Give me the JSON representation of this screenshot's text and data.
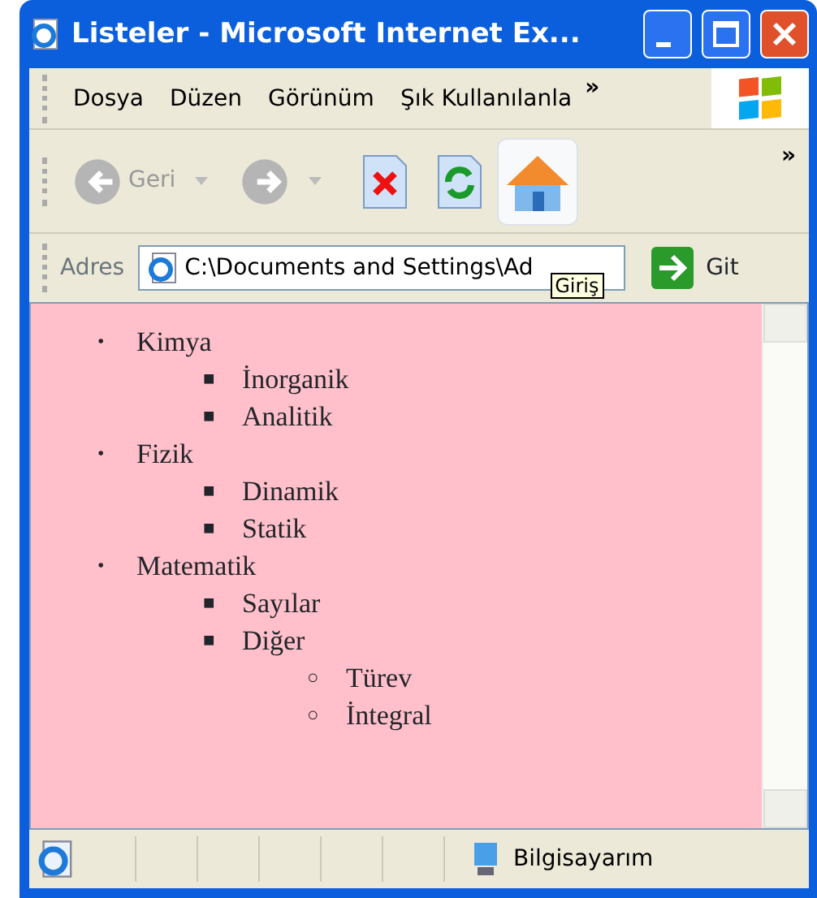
{
  "window": {
    "title": "Listeler - Microsoft Internet Ex..."
  },
  "menu": {
    "items": [
      "Dosya",
      "Düzen",
      "Görünüm",
      "Şık Kullanılanla"
    ],
    "overflow": "»"
  },
  "toolbar": {
    "back": {
      "label": "Geri",
      "disabled": true
    },
    "forward": {
      "disabled": true
    },
    "overflow": "»"
  },
  "address": {
    "label": "Adres",
    "value": "C:\\Documents and Settings\\Ad",
    "tooltip": "Giriş",
    "go_label": "Git"
  },
  "list": [
    {
      "marker": "•",
      "text": "Kimya",
      "children": [
        {
          "marker": "■",
          "text": "İnorganik"
        },
        {
          "marker": "■",
          "text": "Analitik"
        }
      ]
    },
    {
      "marker": "•",
      "text": "Fizik",
      "children": [
        {
          "marker": "■",
          "text": "Dinamik"
        },
        {
          "marker": "■",
          "text": "Statik"
        }
      ]
    },
    {
      "marker": "•",
      "text": "Matematik",
      "children": [
        {
          "marker": "■",
          "text": "Sayılar"
        },
        {
          "marker": "■",
          "text": "Diğer",
          "children": [
            {
              "marker": "○",
              "text": "Türev"
            },
            {
              "marker": "○",
              "text": "İntegral"
            }
          ]
        }
      ]
    }
  ],
  "status_bar": {
    "zone": "Bilgisayarım"
  }
}
